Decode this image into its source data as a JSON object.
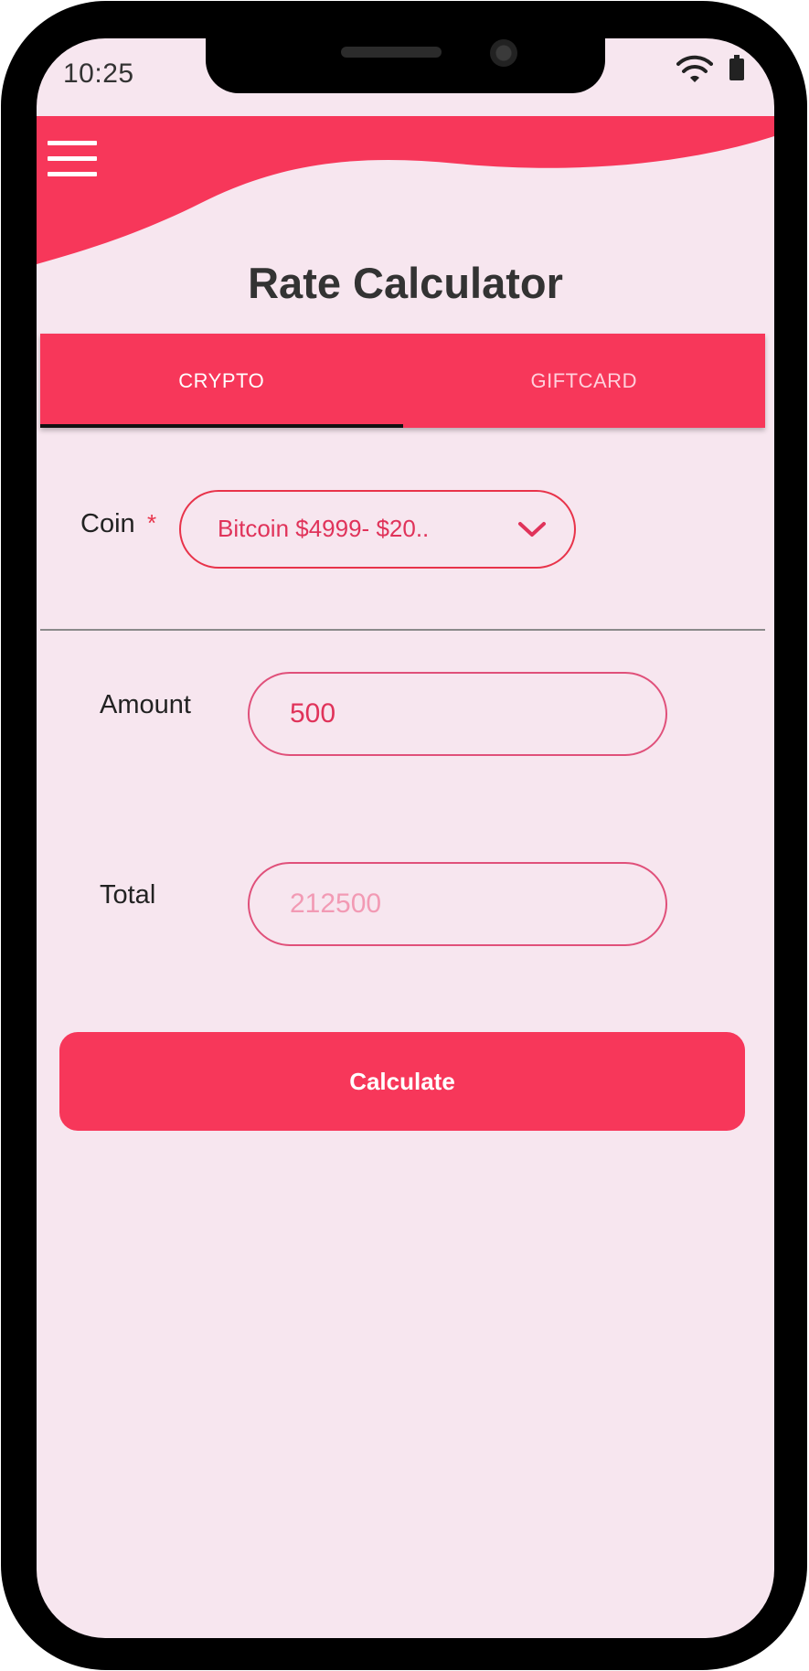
{
  "status_bar": {
    "time": "10:25",
    "icons": [
      "wifi-icon",
      "battery-icon"
    ]
  },
  "header": {
    "menu_icon": "menu-icon",
    "title": "Rate Calculator"
  },
  "tabs": [
    {
      "label": "CRYPTO",
      "active": true
    },
    {
      "label": "GIFTCARD",
      "active": false
    }
  ],
  "form": {
    "coin": {
      "label": "Coin",
      "required_marker": "*",
      "selected_value": "Bitcoin $4999- $20..",
      "icon": "chevron-down-icon"
    },
    "amount": {
      "label": "Amount",
      "value": "500"
    },
    "total": {
      "label": "Total",
      "value": "212500"
    },
    "calculate_label": "Calculate"
  },
  "colors": {
    "accent": "#f7375a",
    "background": "#f7e6ef",
    "field_border": "#e0507a",
    "text_dark": "#333333"
  }
}
